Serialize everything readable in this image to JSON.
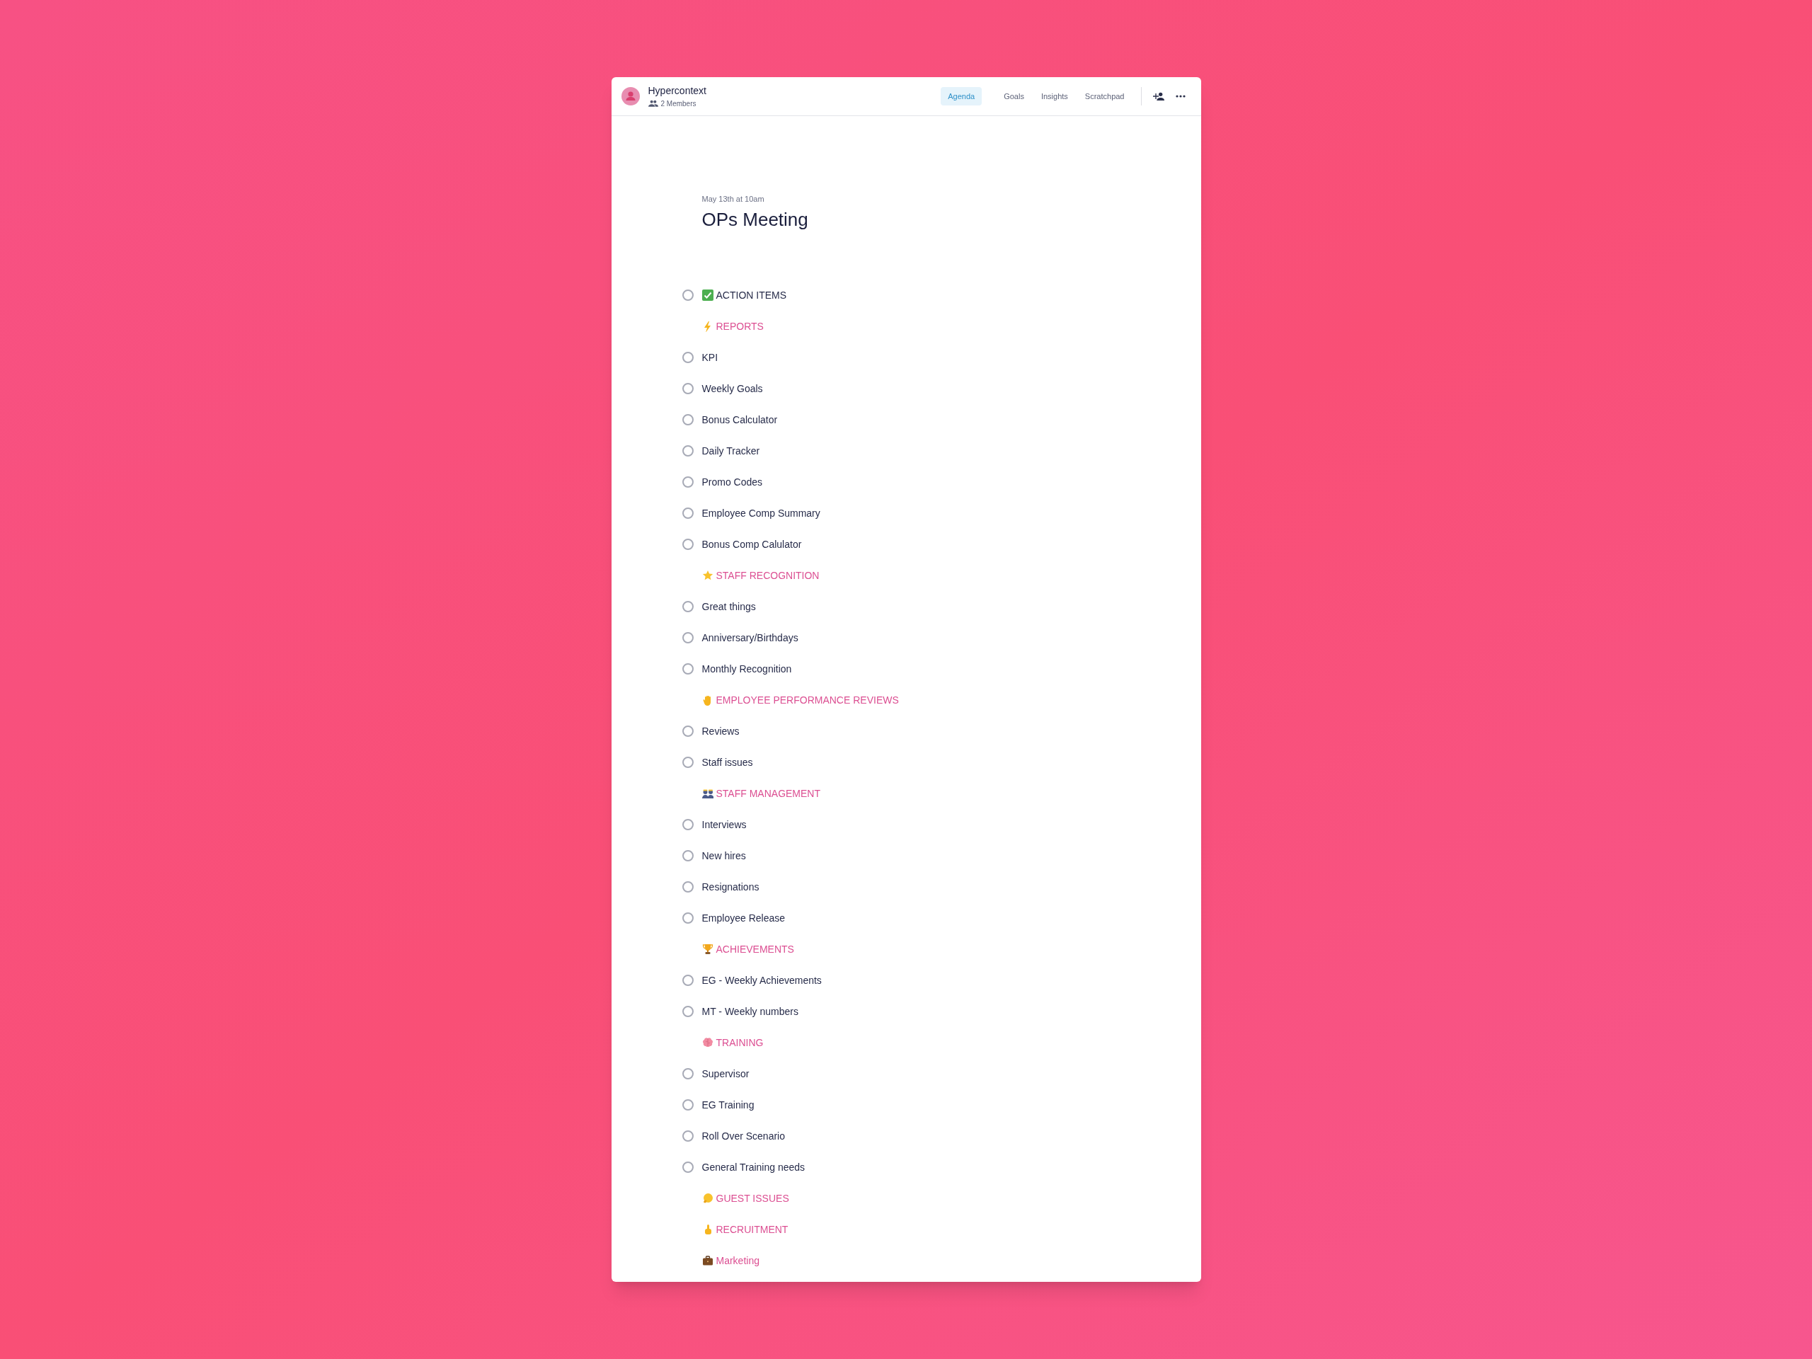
{
  "header": {
    "title": "Hypercontext",
    "members": "2 Members"
  },
  "tabs": [
    {
      "label": "Agenda",
      "selected": true
    },
    {
      "label": "Goals",
      "selected": false
    },
    {
      "label": "Insights",
      "selected": false
    },
    {
      "label": "Scratchpad",
      "selected": false
    }
  ],
  "meeting": {
    "date": "May 13th at 10am",
    "title": "OPs Meeting"
  },
  "agenda": [
    {
      "kind": "tagged",
      "text": "ACTION ITEMS",
      "checked": false
    },
    {
      "kind": "heading",
      "text": "REPORTS"
    },
    {
      "kind": "item",
      "text": "KPI",
      "checked": false
    },
    {
      "kind": "item",
      "text": "Weekly Goals",
      "checked": false
    },
    {
      "kind": "item",
      "text": "Bonus Calculator",
      "checked": false
    },
    {
      "kind": "item",
      "text": "Daily Tracker",
      "checked": false
    },
    {
      "kind": "item",
      "text": "Promo Codes",
      "checked": false
    },
    {
      "kind": "item",
      "text": "Employee Comp Summary",
      "checked": false
    },
    {
      "kind": "item",
      "text": "Bonus Comp Calulator",
      "checked": false
    },
    {
      "kind": "heading",
      "text": "STAFF RECOGNITION"
    },
    {
      "kind": "item",
      "text": "Great things",
      "checked": false
    },
    {
      "kind": "item",
      "text": "Anniversary/Birthdays",
      "checked": false
    },
    {
      "kind": "item",
      "text": "Monthly Recognition",
      "checked": false
    },
    {
      "kind": "heading",
      "text": "EMPLOYEE PERFORMANCE REVIEWS"
    },
    {
      "kind": "item",
      "text": "Reviews",
      "checked": false
    },
    {
      "kind": "item",
      "text": "Staff issues",
      "checked": false
    },
    {
      "kind": "heading",
      "text": "STAFF MANAGEMENT"
    },
    {
      "kind": "item",
      "text": "Interviews",
      "checked": false
    },
    {
      "kind": "item",
      "text": "New hires",
      "checked": false
    },
    {
      "kind": "item",
      "text": "Resignations",
      "checked": false
    },
    {
      "kind": "item",
      "text": "Employee Release",
      "checked": false
    },
    {
      "kind": "heading",
      "text": "ACHIEVEMENTS"
    },
    {
      "kind": "item",
      "text": "EG - Weekly Achievements",
      "checked": false
    },
    {
      "kind": "item",
      "text": "MT - Weekly numbers",
      "checked": false
    },
    {
      "kind": "heading",
      "text": "TRAINING"
    },
    {
      "kind": "item",
      "text": "Supervisor",
      "checked": false
    },
    {
      "kind": "item",
      "text": "EG Training",
      "checked": false
    },
    {
      "kind": "item",
      "text": "Roll Over Scenario",
      "checked": false
    },
    {
      "kind": "item",
      "text": "General Training needs",
      "checked": false
    },
    {
      "kind": "heading",
      "text": "GUEST ISSUES"
    },
    {
      "kind": "heading",
      "text": "RECRUITMENT"
    },
    {
      "kind": "heading",
      "text": "Marketing"
    }
  ]
}
